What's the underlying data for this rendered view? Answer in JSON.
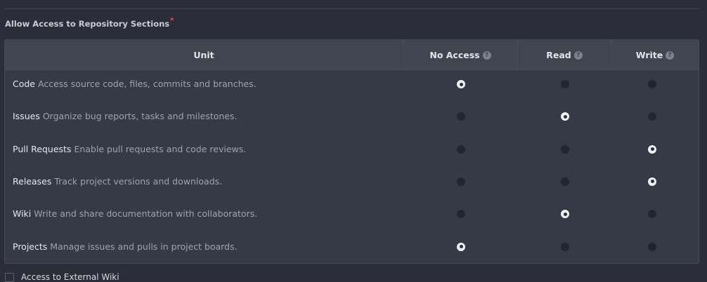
{
  "section": {
    "label": "Allow Access to Repository Sections",
    "required_mark": "*"
  },
  "table": {
    "headers": {
      "unit": "Unit",
      "no_access": "No Access",
      "read": "Read",
      "write": "Write",
      "help_glyph": "?"
    },
    "rows": [
      {
        "name": "Code",
        "desc": "Access source code, files, commits and branches.",
        "selected": "no_access"
      },
      {
        "name": "Issues",
        "desc": "Organize bug reports, tasks and milestones.",
        "selected": "read"
      },
      {
        "name": "Pull Requests",
        "desc": "Enable pull requests and code reviews.",
        "selected": "write"
      },
      {
        "name": "Releases",
        "desc": "Track project versions and downloads.",
        "selected": "write"
      },
      {
        "name": "Wiki",
        "desc": "Write and share documentation with collaborators.",
        "selected": "read"
      },
      {
        "name": "Projects",
        "desc": "Manage issues and pulls in project boards.",
        "selected": "no_access"
      }
    ]
  },
  "bottom": {
    "checkbox_label": "Access to External Wiki"
  },
  "colors": {
    "background": "#2b2e38",
    "table_body": "#363a47",
    "table_header": "#41454f",
    "required": "#e05561",
    "radio_checked": "#f0f1f4",
    "radio_unchecked": "#23262e"
  },
  "icons": {
    "help": "question-circle-icon"
  }
}
